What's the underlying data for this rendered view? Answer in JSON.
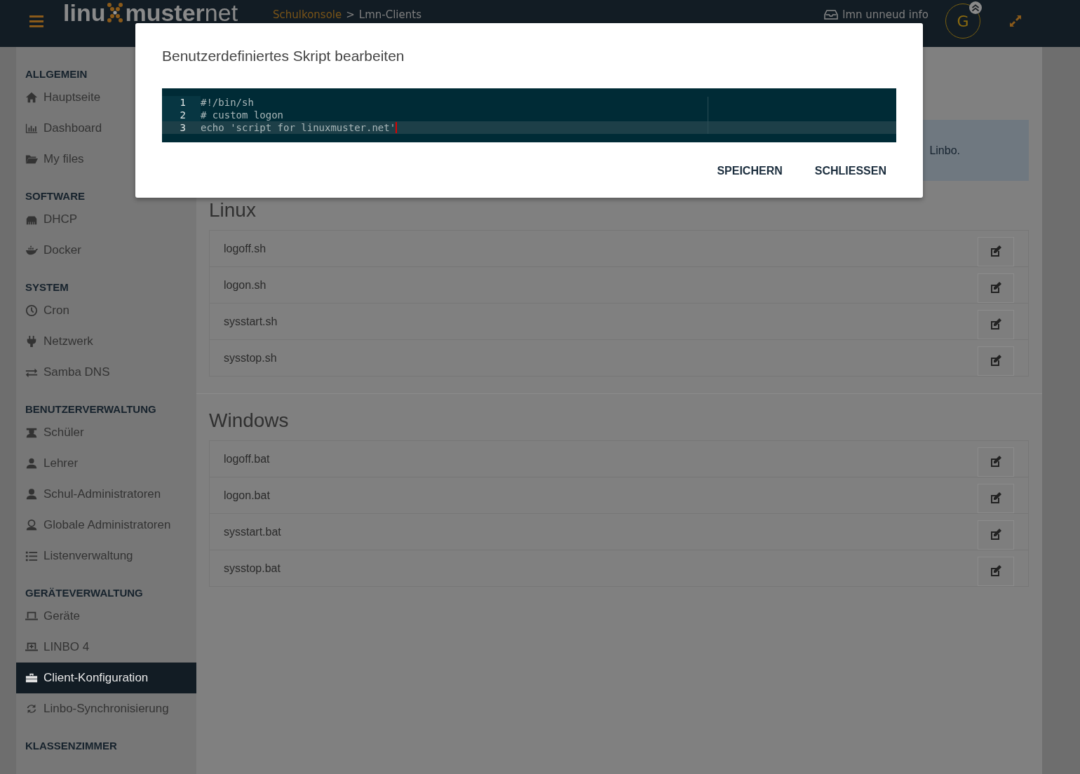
{
  "header": {
    "logo": {
      "part_1": "linu",
      "part_2": "muster",
      "part_3": "net"
    },
    "breadcrumb": {
      "items": [
        "Schulkonsole",
        "Lmn-Clients"
      ],
      "separator": ">"
    },
    "user": {
      "name": "lmn unneud info",
      "avatar_letter": "G"
    }
  },
  "sidebar": {
    "sections": [
      {
        "title": "ALLGEMEIN",
        "items": [
          {
            "label": "Hauptseite",
            "selected": false
          },
          {
            "label": "Dashboard",
            "selected": false
          },
          {
            "label": "My files",
            "selected": false
          }
        ]
      },
      {
        "title": "SOFTWARE",
        "items": [
          {
            "label": "DHCP",
            "selected": false
          },
          {
            "label": "Docker",
            "selected": false
          }
        ]
      },
      {
        "title": "SYSTEM",
        "items": [
          {
            "label": "Cron",
            "selected": false
          },
          {
            "label": "Netzwerk",
            "selected": false
          },
          {
            "label": "Samba DNS",
            "selected": false
          }
        ]
      },
      {
        "title": "BENUTZERVERWALTUNG",
        "items": [
          {
            "label": "Schüler",
            "selected": false
          },
          {
            "label": "Lehrer",
            "selected": false
          },
          {
            "label": "Schul-Administratoren",
            "selected": false
          },
          {
            "label": "Globale Administratoren",
            "selected": false
          },
          {
            "label": "Listenverwaltung",
            "selected": false
          }
        ]
      },
      {
        "title": "GERÄTEVERWALTUNG",
        "items": [
          {
            "label": "Geräte",
            "selected": false
          },
          {
            "label": "LINBO 4",
            "selected": false
          },
          {
            "label": "Client-Konfiguration",
            "selected": true
          },
          {
            "label": "Linbo-Synchronisierung",
            "selected": false
          }
        ]
      },
      {
        "title": "KLASSENZIMMER"
      }
    ]
  },
  "info": {
    "text": "Linbo."
  },
  "script_groups": [
    {
      "title": "Linux",
      "scripts": [
        "logoff.sh",
        "logon.sh",
        "sysstart.sh",
        "sysstop.sh"
      ]
    },
    {
      "title": "Windows",
      "scripts": [
        "logoff.bat",
        "logon.bat",
        "sysstart.bat",
        "sysstop.bat"
      ]
    }
  ],
  "modal": {
    "title": "Benutzerdefiniertes Skript bearbeiten",
    "lines": [
      {
        "number": "1",
        "text": "#!/bin/sh",
        "active": false
      },
      {
        "number": "2",
        "text": "# custom logon",
        "active": false
      },
      {
        "number": "3",
        "text": "echo 'script for linuxmuster.net'",
        "active": true
      }
    ],
    "buttons": [
      "SPEICHERN",
      "SCHLIESSEN"
    ]
  }
}
